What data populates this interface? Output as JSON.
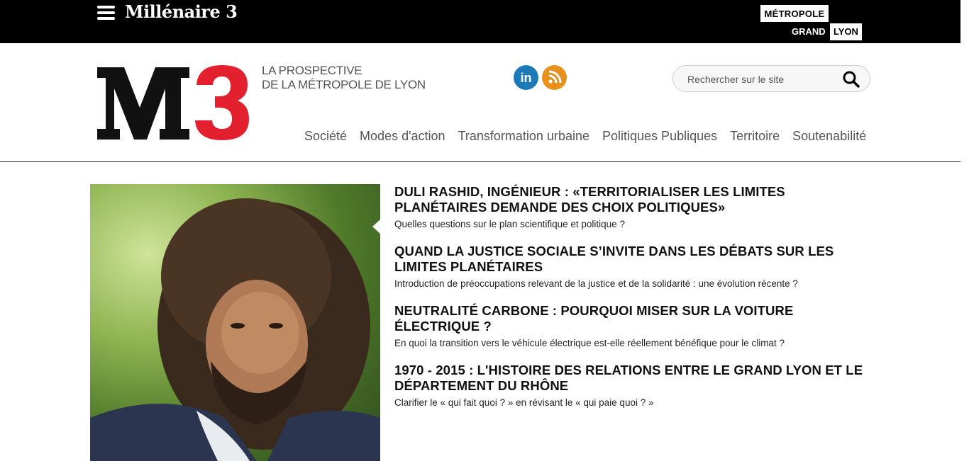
{
  "topbar": {
    "brand": "Millénaire 3",
    "metropole": {
      "line1": "MÉTROPOLE",
      "line2a": "GRAND",
      "line2b": "LYON"
    }
  },
  "header": {
    "logo_text": "M3",
    "tagline_line1": "La Prospective",
    "tagline_line2": "de la Métropole de Lyon",
    "social": [
      {
        "icon": "linkedin-icon",
        "label": "in",
        "color": "#1d7ab8"
      },
      {
        "icon": "rss-icon",
        "color": "#e8911c"
      }
    ],
    "search": {
      "placeholder": "Rechercher sur le site"
    }
  },
  "nav": {
    "items": [
      {
        "label": "Société"
      },
      {
        "label": "Modes d'action"
      },
      {
        "label": "Transformation urbaine"
      },
      {
        "label": "Politiques Publiques"
      },
      {
        "label": "Territoire"
      },
      {
        "label": "Soutenabilité"
      }
    ]
  },
  "articles": [
    {
      "title": "Duli Rashid, ingénieur : «Territorialiser les limites planétaires demande des choix politiques»",
      "summary": "Quelles questions sur le plan scientifique et politique ?"
    },
    {
      "title": "Quand la justice sociale s’invite dans les débats sur les limites planétaires",
      "summary": "Introduction de préoccupations relevant de la justice et de la solidarité : une évolution récente ?"
    },
    {
      "title": "Neutralité carbone : pourquoi miser sur la voiture électrique ?",
      "summary": "En quoi la transition vers le véhicule électrique est-elle réellement bénéfique pour le climat ?"
    },
    {
      "title": "1970 - 2015 : L'histoire des relations entre le Grand Lyon et le Département du Rhône",
      "summary": "Clarifier le « qui fait quoi ? » en révisant le « qui paie quoi ? »"
    }
  ],
  "colors": {
    "logo_black": "#111111",
    "logo_red": "#e3202e",
    "topbar": "#000000"
  }
}
